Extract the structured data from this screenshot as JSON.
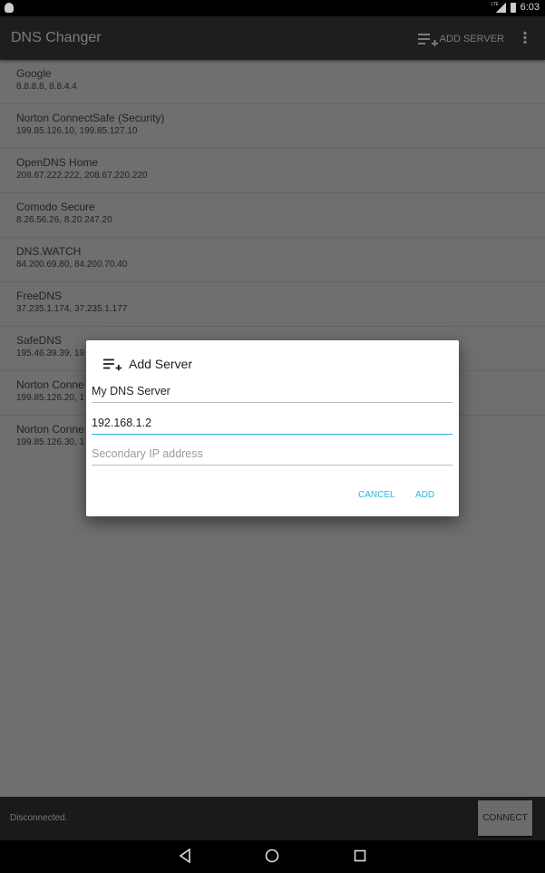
{
  "status_bar": {
    "time": "6:03",
    "network": "LTE"
  },
  "toolbar": {
    "title": "DNS Changer",
    "add_server_label": "ADD SERVER",
    "add_icon": "playlist-add-icon",
    "menu_icon": "more-vert-icon"
  },
  "servers": [
    {
      "name": "Google",
      "ips": "8.8.8.8, 8.8.4.4"
    },
    {
      "name": "Norton ConnectSafe (Security)",
      "ips": "199.85.126.10, 199.85.127.10"
    },
    {
      "name": "OpenDNS Home",
      "ips": "208.67.222.222, 208.67.220.220"
    },
    {
      "name": "Comodo Secure",
      "ips": "8.26.56.26, 8.20.247.20"
    },
    {
      "name": "DNS.WATCH",
      "ips": "84.200.69.80, 84.200.70.40"
    },
    {
      "name": "FreeDNS",
      "ips": "37.235.1.174, 37.235.1.177"
    },
    {
      "name": "SafeDNS",
      "ips": "195.46.39.39, 19"
    },
    {
      "name": "Norton Conne",
      "ips": "199.85.126.20, 1"
    },
    {
      "name": "Norton Conne",
      "ips": "199.85.126.30, 1"
    }
  ],
  "dialog": {
    "title": "Add Server",
    "name_value": "My DNS Server",
    "primary_value": "192.168.1.2",
    "secondary_placeholder": "Secondary IP address",
    "cancel": "CANCEL",
    "add": "ADD"
  },
  "bottom": {
    "status": "Disconnected.",
    "connect": "CONNECT"
  },
  "colors": {
    "accent": "#2ab6e2",
    "toolbar": "#1e1e1f"
  }
}
